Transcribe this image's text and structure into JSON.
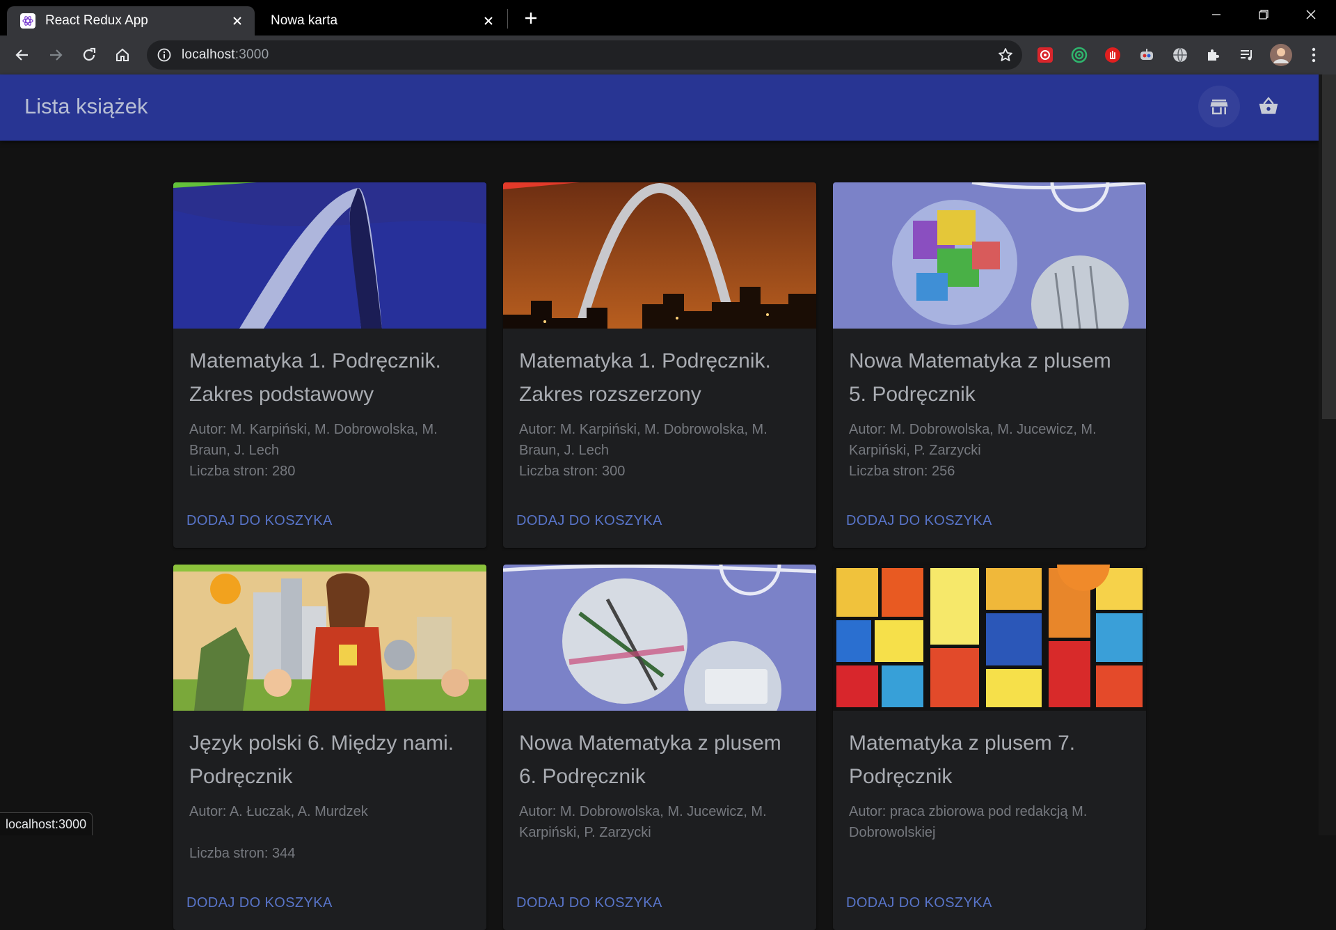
{
  "browser": {
    "tabs": [
      {
        "label": "React Redux App",
        "active": true
      },
      {
        "label": "Nowa karta",
        "active": false
      }
    ],
    "url": {
      "host": "localhost",
      "port": ":3000"
    },
    "status_text": "localhost:3000",
    "extensions": [
      "red-extension-icon",
      "green-target-icon",
      "red-hand-icon",
      "robot-extension-icon",
      "globe-extension-icon",
      "puzzle-icon",
      "media-queue-icon",
      "profile-avatar"
    ]
  },
  "app": {
    "title": "Lista książek",
    "accent": "#283593",
    "link_color": "#5874c8"
  },
  "books": [
    {
      "title": "Matematyka 1. Podręcznik. Zakres podstawowy",
      "author": "Autor: M. Karpiński, M. Dobrowolska, M. Braun, J. Lech",
      "pages": "Liczba stron: 280",
      "cta": "DODAJ DO KOSZYKA"
    },
    {
      "title": "Matematyka 1. Podręcznik. Zakres rozszerzony",
      "author": "Autor: M. Karpiński, M. Dobrowolska, M. Braun, J. Lech",
      "pages": "Liczba stron: 300",
      "cta": "DODAJ DO KOSZYKA"
    },
    {
      "title": "Nowa Matematyka z plusem 5. Podręcznik",
      "author": "Autor: M. Dobrowolska, M. Jucewicz, M. Karpiński, P. Zarzycki",
      "pages": "Liczba stron: 256",
      "cta": "DODAJ DO KOSZYKA"
    },
    {
      "title": "Język polski 6. Między nami. Podręcznik",
      "author": "Autor: A. Łuczak, A. Murdzek",
      "pages": "Liczba stron: 344",
      "cta": "DODAJ DO KOSZYKA"
    },
    {
      "title": "Nowa Matematyka z plusem 6. Podręcznik",
      "author": "Autor: M. Dobrowolska, M. Jucewicz, M. Karpiński, P. Zarzycki",
      "pages": "",
      "cta": "DODAJ DO KOSZYKA"
    },
    {
      "title": "Matematyka z plusem 7. Podręcznik",
      "author": "Autor: praca zbiorowa pod redakcją M. Dobrowolskiej",
      "pages": "",
      "cta": "DODAJ DO KOSZYKA"
    }
  ]
}
